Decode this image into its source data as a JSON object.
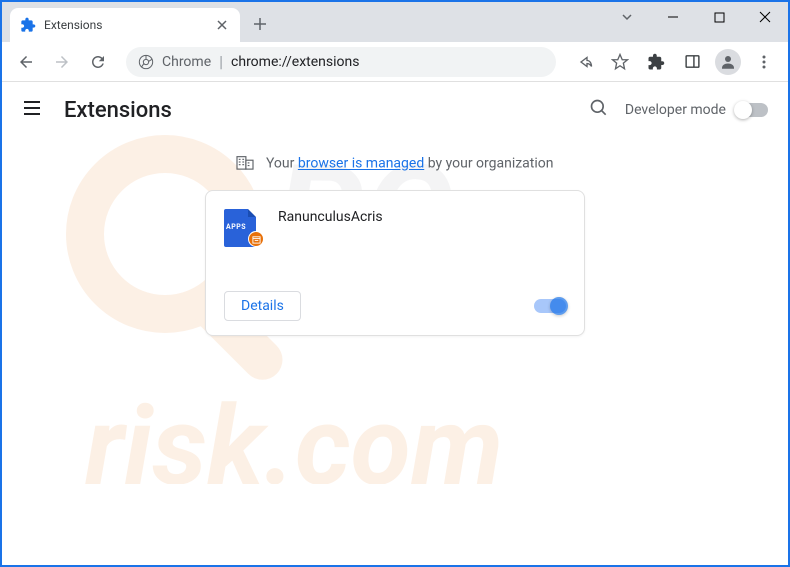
{
  "window": {
    "tab_title": "Extensions",
    "url_prefix": "Chrome",
    "url_path": "chrome://extensions"
  },
  "header": {
    "title": "Extensions",
    "developer_mode_label": "Developer mode"
  },
  "banner": {
    "prefix": "Your ",
    "link": "browser is managed",
    "suffix": " by your organization"
  },
  "extension": {
    "name": "RanunculusAcris",
    "icon_text": "APPS",
    "details_label": "Details",
    "enabled": true
  }
}
